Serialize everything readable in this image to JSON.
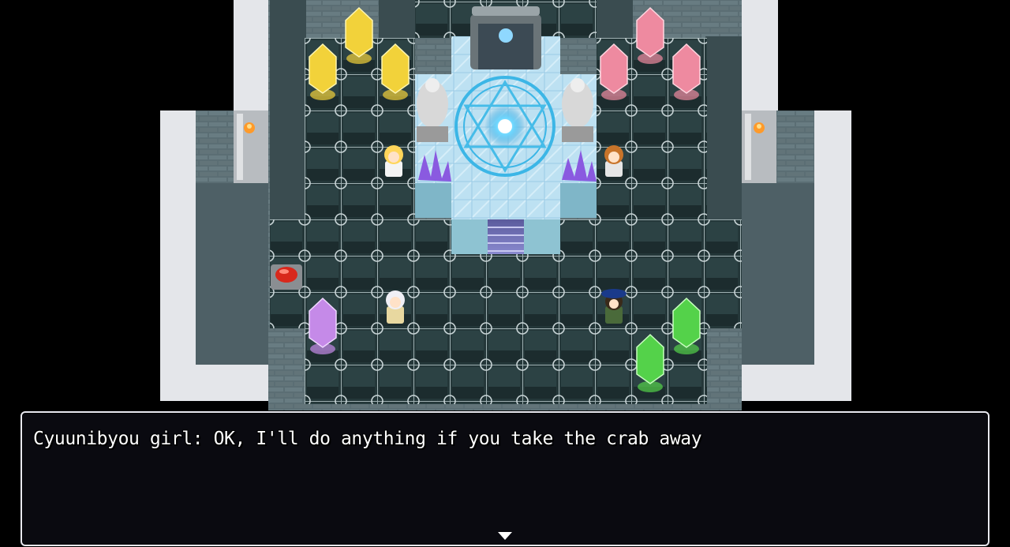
{
  "dialog": {
    "text": "Cyuunibyou girl: OK, I'll do anything if you take the crab away"
  },
  "scene": {
    "colors": {
      "background": "#000000",
      "snow": "#e2e4e8",
      "wall": "#5d7076",
      "floor": "#263a3c",
      "grid": "#aab8ba",
      "ice": "#bfe4f4",
      "magic_circle": "#3eb8e8"
    },
    "crystals": [
      {
        "name": "yellow-crystal",
        "color": "#f2d23a"
      },
      {
        "name": "pink-crystal",
        "color": "#ee8aa0"
      },
      {
        "name": "purple-crystal",
        "color": "#c58ae8"
      },
      {
        "name": "green-crystal",
        "color": "#54d24a"
      }
    ]
  }
}
